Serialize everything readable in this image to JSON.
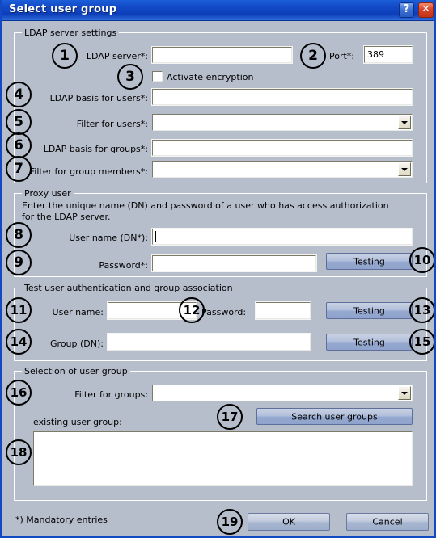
{
  "window": {
    "title": "Select user group",
    "help_button": "?",
    "close_button": "✕"
  },
  "groups": {
    "ldap_server_settings": "LDAP server settings",
    "proxy_user": "Proxy user",
    "test_user_auth": "Test user authentication and group association",
    "selection_user_group": "Selection of user group"
  },
  "ldap": {
    "server_label": "LDAP server*:",
    "server_value": "",
    "port_label": "Port*:",
    "port_value": "389",
    "activate_encryption_label": "Activate encryption",
    "activate_encryption_checked": false,
    "basis_users_label": "LDAP basis for users*:",
    "basis_users_value": "",
    "filter_users_label": "Filter for users*:",
    "filter_users_value": "",
    "basis_groups_label": "LDAP basis for groups*:",
    "basis_groups_value": "",
    "filter_group_members_label": "Filter for group members*:",
    "filter_group_members_value": ""
  },
  "proxy": {
    "description": "Enter the unique name (DN) and password of a user who has access authorization for the LDAP server.",
    "username_label": "User name (DN*):",
    "username_value": "",
    "password_label": "Password*:",
    "password_value": "",
    "test_button": "Testing"
  },
  "test_auth": {
    "username_label": "User name:",
    "username_value": "",
    "password_label": "Password:",
    "password_value": "",
    "test_button_1": "Testing",
    "group_dn_label": "Group (DN):",
    "group_dn_value": "",
    "test_button_2": "Testing"
  },
  "selection": {
    "filter_groups_label": "Filter for groups:",
    "filter_groups_value": "",
    "search_button": "Search user groups",
    "existing_group_label": "existing user group:",
    "list_items": []
  },
  "footer": {
    "mandatory_note": "*) Mandatory entries",
    "ok_button": "OK",
    "cancel_button": "Cancel"
  },
  "markers": {
    "m1": "1",
    "m2": "2",
    "m3": "3",
    "m4": "4",
    "m5": "5",
    "m6": "6",
    "m7": "7",
    "m8": "8",
    "m9": "9",
    "m10": "10",
    "m11": "11",
    "m12": "12",
    "m13": "13",
    "m14": "14",
    "m15": "15",
    "m16": "16",
    "m17": "17",
    "m18": "18",
    "m19": "19"
  },
  "colors": {
    "title_bar": "#1449c6",
    "dialog_bg": "#b6bdcb",
    "close_button": "#d9442a",
    "button_face": "#a8b6d0"
  }
}
